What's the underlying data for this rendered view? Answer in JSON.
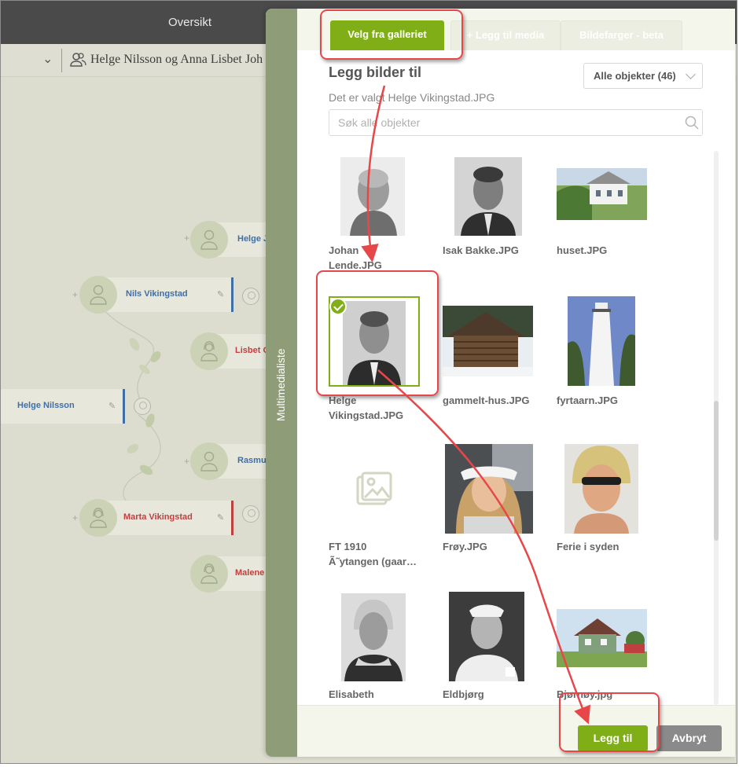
{
  "app": {
    "top_title": "Oversikt",
    "breadcrumb_person": "Helge Nilsson og Anna Lisbet Joh"
  },
  "tree": {
    "people": [
      {
        "name": "Helge J",
        "gender": "m"
      },
      {
        "name": "Nils Vikingstad",
        "gender": "m"
      },
      {
        "name": "Lisbet O",
        "gender": "f"
      },
      {
        "name": "Helge Nilsson",
        "gender": "m"
      },
      {
        "name": "Rasmu",
        "gender": "m"
      },
      {
        "name": "Marta Vikingstad",
        "gender": "f"
      },
      {
        "name": "Malene",
        "gender": "f"
      }
    ]
  },
  "modal": {
    "side_label": "Multimedialiste",
    "tabs": [
      {
        "label": "Velg fra galleriet",
        "active": true
      },
      {
        "label": "+ Legg til media",
        "active": false
      },
      {
        "label": "Bildefarger - beta",
        "active": false
      }
    ],
    "heading": "Legg bilder til",
    "selected_text": "Det er valgt Helge Vikingstad.JPG",
    "filter": {
      "selected": "Alle objekter (46)"
    },
    "search_placeholder": "Søk alle objekter",
    "items": [
      {
        "caption": "Johan\nLende.JPG",
        "selected": false
      },
      {
        "caption": "Isak Bakke.JPG",
        "selected": false
      },
      {
        "caption": "huset.JPG",
        "selected": false
      },
      {
        "caption": "Helge\nVikingstad.JPG",
        "selected": true
      },
      {
        "caption": "gammelt-hus.JPG",
        "selected": false
      },
      {
        "caption": "fyrtaarn.JPG",
        "selected": false
      },
      {
        "caption": "FT 1910\nÃ˜ytangen (gaar…",
        "selected": false
      },
      {
        "caption": "Frøy.JPG",
        "selected": false
      },
      {
        "caption": "Ferie i syden",
        "selected": false
      },
      {
        "caption": "Elisabeth\nSvendsen.JPG",
        "selected": false
      },
      {
        "caption": "Eldbjørg\nHaaland.JPG",
        "selected": false
      },
      {
        "caption": "Bjørnøy.jpg",
        "selected": false
      }
    ],
    "buttons": {
      "add": "Legg til",
      "cancel": "Avbryt"
    }
  },
  "colors": {
    "accent_green": "#7fae16",
    "annotation_red": "#e8474a",
    "male_name": "#3f6fa6",
    "female_name": "#c04040"
  }
}
